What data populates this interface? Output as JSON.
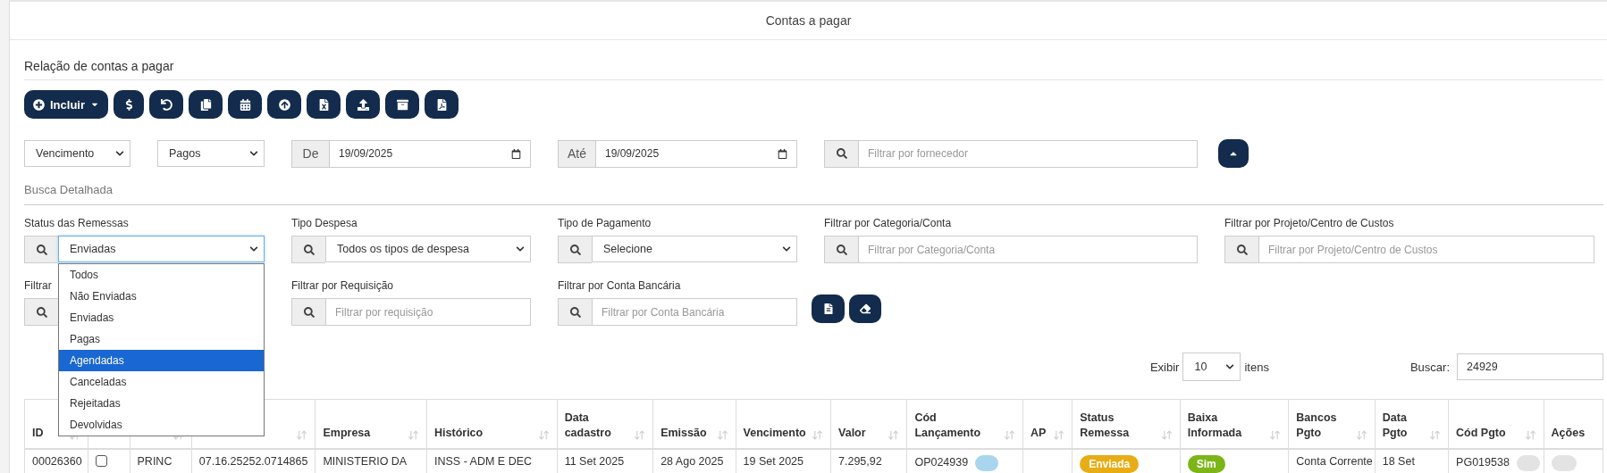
{
  "page_title": "Contas a pagar",
  "section_title": "Relação de contas a pagar",
  "include_button": "Incluir",
  "top_filters": {
    "date_field": "Vencimento",
    "payment_state": "Pagos",
    "from_label": "De",
    "from_date": "19/09/2025",
    "to_label": "Até",
    "to_date": "19/09/2025",
    "supplier_placeholder": "Filtrar por fornecedor"
  },
  "detail_title": "Busca Detalhada",
  "detail_filters": [
    {
      "kind": "select",
      "label": "Status das Remessas",
      "value": "Enviadas",
      "focused": true
    },
    {
      "kind": "select",
      "label": "Tipo Despesa",
      "value": "Todos os tipos de despesa",
      "focused": false
    },
    {
      "kind": "select",
      "label": "Tipo de Pagamento",
      "value": "Selecione",
      "focused": false
    },
    {
      "kind": "text",
      "label": "Filtrar por Categoria/Conta",
      "placeholder": "Filtrar por Categoria/Conta"
    },
    {
      "kind": "text",
      "label": "Filtrar por Projeto/Centro de Custos",
      "placeholder": "Filtrar por Projeto/Centro de Custos"
    },
    {
      "kind": "covered",
      "label": "Filtrar"
    },
    {
      "kind": "text",
      "label": "Filtrar por Requisição",
      "placeholder": "Filtrar por requisição"
    },
    {
      "kind": "text",
      "label": "Filtrar por Conta Bancária",
      "placeholder": "Filtrar por Conta Bancária"
    }
  ],
  "status_options": [
    {
      "label": "Todos",
      "selected": false
    },
    {
      "label": "Não Enviadas",
      "selected": false
    },
    {
      "label": "Enviadas",
      "selected": false
    },
    {
      "label": "Pagas",
      "selected": false
    },
    {
      "label": "Agendadas",
      "selected": true
    },
    {
      "label": "Canceladas",
      "selected": false
    },
    {
      "label": "Rejeitadas",
      "selected": false
    },
    {
      "label": "Devolvidas",
      "selected": false
    }
  ],
  "page_size": {
    "label": "Exibir",
    "value": "10",
    "suffix": "itens"
  },
  "search": {
    "label": "Buscar:",
    "value": "24929"
  },
  "table": {
    "columns": [
      {
        "label": "ID",
        "sortable": true
      },
      {
        "sortable": false
      },
      {
        "sortable": true
      },
      {
        "sortable": true
      },
      {
        "label": "Empresa",
        "sortable": true
      },
      {
        "label": "Histórico",
        "sortable": true
      },
      {
        "label": "Data\ncadastro",
        "sortable": true
      },
      {
        "label": "Emissão",
        "sortable": true
      },
      {
        "label": "Vencimento",
        "sortable": true
      },
      {
        "label": "Valor",
        "sortable": true
      },
      {
        "label": "Cód\nLançamento",
        "sortable": true
      },
      {
        "label": "AP",
        "sortable": true
      },
      {
        "label": "Status\nRemessa",
        "sortable": true
      },
      {
        "label": "Baixa\nInformada",
        "sortable": true
      },
      {
        "label": "Bancos\nPgto",
        "sortable": true
      },
      {
        "label": "Data\nPgto",
        "sortable": true
      },
      {
        "label": "Cód Pgto",
        "sortable": true
      },
      {
        "label": "Ações",
        "sortable": false
      }
    ],
    "rows": [
      {
        "cells": [
          {
            "kind": "text",
            "text": "00026360"
          },
          {
            "kind": "checkbox",
            "checked": false
          },
          {
            "kind": "text",
            "text": "PRINC"
          },
          {
            "kind": "text",
            "text": "07.16.25252.0714865"
          },
          {
            "kind": "text",
            "text": "MINISTERIO DA"
          },
          {
            "kind": "text",
            "text": "INSS - ADM E DEC"
          },
          {
            "kind": "text",
            "text": "11 Set 2025"
          },
          {
            "kind": "text",
            "text": "28 Ago 2025"
          },
          {
            "kind": "text",
            "text": "19 Set 2025"
          },
          {
            "kind": "text",
            "text": "7.295,92"
          },
          {
            "kind": "code",
            "text": "OP024939",
            "color": "#a9d6ee"
          },
          {
            "kind": "empty"
          },
          {
            "kind": "badge",
            "text": "Enviada",
            "color": "#e8ad16"
          },
          {
            "kind": "badge",
            "text": "Sim",
            "color": "#7cb518"
          },
          {
            "kind": "text",
            "text": "Conta Corrente"
          },
          {
            "kind": "text",
            "text": "18 Set"
          },
          {
            "kind": "code",
            "text": "PG019538",
            "color": "#e3e3e3"
          },
          {
            "kind": "action"
          }
        ]
      }
    ]
  }
}
